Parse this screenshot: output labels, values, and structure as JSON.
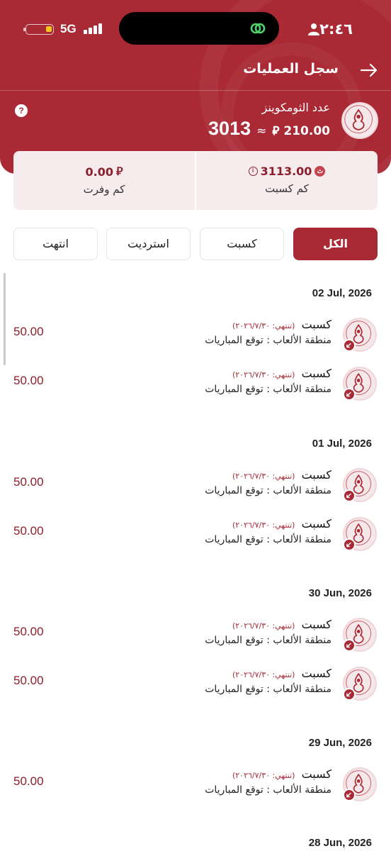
{
  "status_bar": {
    "time": "٢:٤٦",
    "network": "5G"
  },
  "header": {
    "title": "سجل العمليات",
    "count_label": "عدد الثومكوينز",
    "count_value": "3013",
    "approx_symbol": "≈",
    "sar_value": "210.00",
    "currency_symbol": "⃁"
  },
  "summary": {
    "earned_value": "3113.00",
    "earned_label": "كم كسبت",
    "saved_value": "0.00",
    "saved_label": "كم وفرت"
  },
  "tabs": [
    {
      "label": "الكل",
      "active": true
    },
    {
      "label": "كسبت",
      "active": false
    },
    {
      "label": "استرديت",
      "active": false
    },
    {
      "label": "انتهت",
      "active": false
    }
  ],
  "groups": [
    {
      "date": "02 Jul, 2026",
      "items": [
        {
          "type": "كسبت",
          "expiry": "(تنتهي: ٢٠٢٦/٧/٣٠)",
          "description": "منطقة الألعاب : توقع المباريات",
          "amount": "50.00"
        },
        {
          "type": "كسبت",
          "expiry": "(تنتهي: ٢٠٢٦/٧/٣٠)",
          "description": "منطقة الألعاب : توقع المباريات",
          "amount": "50.00"
        }
      ]
    },
    {
      "date": "01 Jul, 2026",
      "items": [
        {
          "type": "كسبت",
          "expiry": "(تنتهي: ٢٠٢٦/٧/٣٠)",
          "description": "منطقة الألعاب : توقع المباريات",
          "amount": "50.00"
        },
        {
          "type": "كسبت",
          "expiry": "(تنتهي: ٢٠٢٦/٧/٣٠)",
          "description": "منطقة الألعاب : توقع المباريات",
          "amount": "50.00"
        }
      ]
    },
    {
      "date": "30 Jun, 2026",
      "items": [
        {
          "type": "كسبت",
          "expiry": "(تنتهي: ٢٠٢٦/٧/٣٠)",
          "description": "منطقة الألعاب : توقع المباريات",
          "amount": "50.00"
        },
        {
          "type": "كسبت",
          "expiry": "(تنتهي: ٢٠٢٦/٧/٣٠)",
          "description": "منطقة الألعاب : توقع المباريات",
          "amount": "50.00"
        }
      ]
    },
    {
      "date": "29 Jun, 2026",
      "items": [
        {
          "type": "كسبت",
          "expiry": "(تنتهي: ٢٠٢٦/٧/٣٠)",
          "description": "منطقة الألعاب : توقع المباريات",
          "amount": "50.00"
        }
      ]
    },
    {
      "date": "28 Jun, 2026",
      "items": []
    }
  ],
  "colors": {
    "brand": "#a92a35",
    "amount": "#8d1f2a",
    "card_bg": "#f6ecee"
  },
  "icons": [
    "battery-icon",
    "signal-icon",
    "link-icon",
    "person-icon",
    "back-arrow-icon",
    "help-icon",
    "brand-logo-icon",
    "earned-coin-icon",
    "info-icon",
    "riyal-icon",
    "incoming-arrow-icon"
  ]
}
